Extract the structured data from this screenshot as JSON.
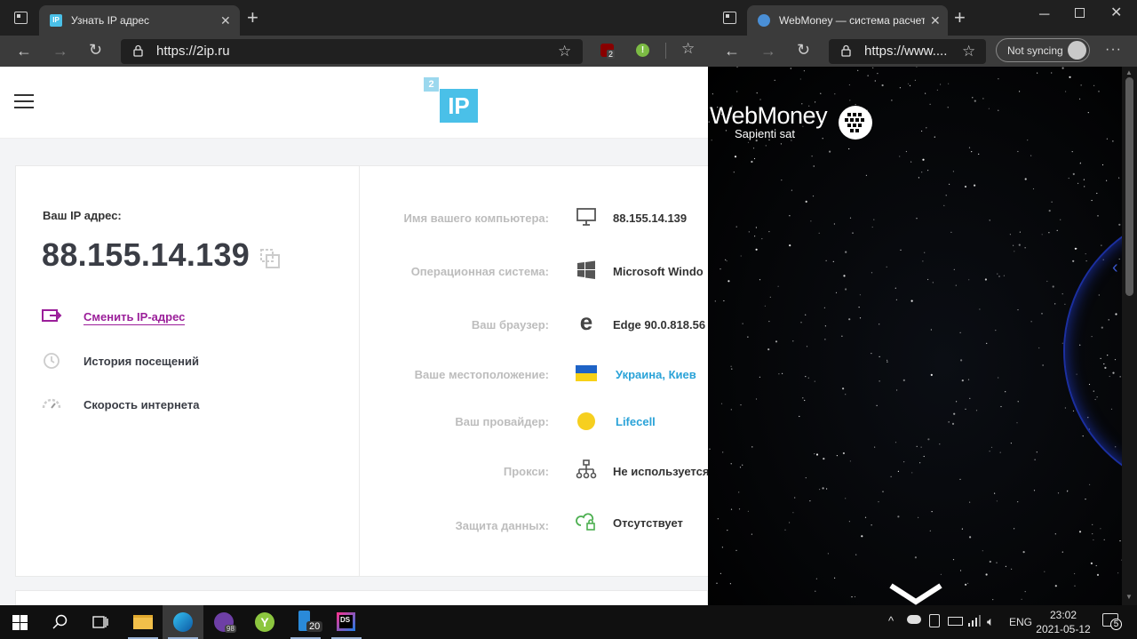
{
  "left_browser": {
    "tab_title": "Узнать IP адрес",
    "tab_favicon": "IP",
    "url": "https://2ip.ru",
    "ext_badge": "2"
  },
  "page_2ip": {
    "logo_small": "2",
    "logo_main": "IP",
    "ip_label": "Ваш IP адрес:",
    "ip_value": "88.155.14.139",
    "actions": [
      {
        "label": "Сменить IP-адрес"
      },
      {
        "label": "История посещений"
      },
      {
        "label": "Скорость интернета"
      }
    ],
    "rows": [
      {
        "label": "Имя вашего компьютера:",
        "value": "88.155.14.139"
      },
      {
        "label": "Операционная система:",
        "value": "Microsoft Windo"
      },
      {
        "label": "Ваш браузер:",
        "value": "Edge 90.0.818.56"
      },
      {
        "label": "Ваше местоположение:",
        "value": "Украина, Киев"
      },
      {
        "label": "Ваш провайдер:",
        "value": "Lifecell"
      },
      {
        "label": "Прокси:",
        "value": "Не используется"
      },
      {
        "label": "Защита данных:",
        "value": "Отсутствует"
      }
    ]
  },
  "right_browser": {
    "tab_title": "WebMoney — система расчетов",
    "url": "https://www....",
    "sync_label": "Not syncing"
  },
  "webmoney_page": {
    "brand": "WebMoney",
    "tagline": "Sapienti sat"
  },
  "taskbar": {
    "badge_app1": "98",
    "badge_app2": "20",
    "language": "ENG",
    "time": "23:02",
    "date": "2021-05-12",
    "notifications": "5"
  },
  "colors": {
    "accent_2ip": "#4ac0e8",
    "link_purple": "#9b1f9a",
    "location_blue": "#2ba3d8"
  }
}
